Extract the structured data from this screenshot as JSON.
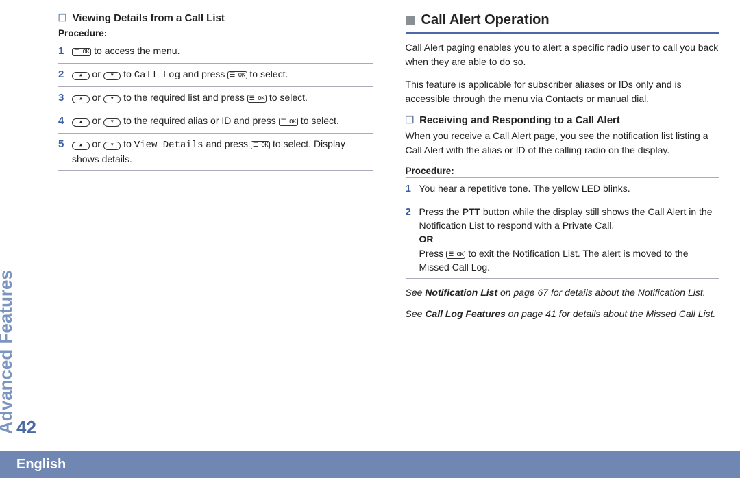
{
  "rail": {
    "chapter": "Advanced Features",
    "page_number": "42"
  },
  "footer": {
    "language": "English"
  },
  "icons": {
    "ok": "☰ OK",
    "up": "▴",
    "down": "▾"
  },
  "left": {
    "sub_heading": "Viewing Details from a Call List",
    "procedure_label": "Procedure:",
    "steps": [
      {
        "n": "1",
        "parts": [
          "[OK]",
          " to access the menu."
        ]
      },
      {
        "n": "2",
        "parts": [
          "[UP]",
          " or ",
          "[DOWN]",
          " to ",
          {
            "mono": "Call Log"
          },
          " and press ",
          "[OK]",
          " to select."
        ]
      },
      {
        "n": "3",
        "parts": [
          "[UP]",
          " or ",
          "[DOWN]",
          " to the required list and press ",
          "[OK]",
          " to select."
        ]
      },
      {
        "n": "4",
        "parts": [
          "[UP]",
          " or ",
          "[DOWN]",
          " to the required alias or ID and press ",
          "[OK]",
          " to select."
        ]
      },
      {
        "n": "5",
        "parts": [
          "[UP]",
          " or ",
          "[DOWN]",
          " to ",
          {
            "mono": "View Details"
          },
          " and press ",
          "[OK]",
          " to select. Display shows details."
        ]
      }
    ]
  },
  "right": {
    "section_title": "Call Alert Operation",
    "intro1": "Call Alert paging enables you to alert a specific radio user to call you back when they are able to do so.",
    "intro2": "This feature is applicable for subscriber aliases or IDs only and is accessible through the menu via Contacts or manual dial.",
    "sub_heading": "Receiving and Responding to a Call Alert",
    "sub_para": "When you receive a Call Alert page, you see the notification list listing a Call Alert with the alias or ID of the calling radio on the display.",
    "procedure_label": "Procedure:",
    "steps": [
      {
        "n": "1",
        "parts": [
          "You hear a repetitive tone. The yellow LED blinks."
        ]
      },
      {
        "n": "2",
        "parts": [
          "Press the ",
          {
            "b": "PTT"
          },
          " button while the display still shows the Call Alert in the Notification List to respond with a Private Call.",
          {
            "br": true
          },
          {
            "b": "OR"
          },
          {
            "br": true
          },
          "Press ",
          "[OK]",
          " to exit the Notification List. The alert is moved to the Missed Call Log."
        ]
      }
    ],
    "see1_pre": "See ",
    "see1_bold": "Notification List",
    "see1_post": " on page 67 for details about the Notification List.",
    "see2_pre": "See ",
    "see2_bold": "Call Log Features",
    "see2_post": " on page 41 for details about the Missed Call List."
  }
}
